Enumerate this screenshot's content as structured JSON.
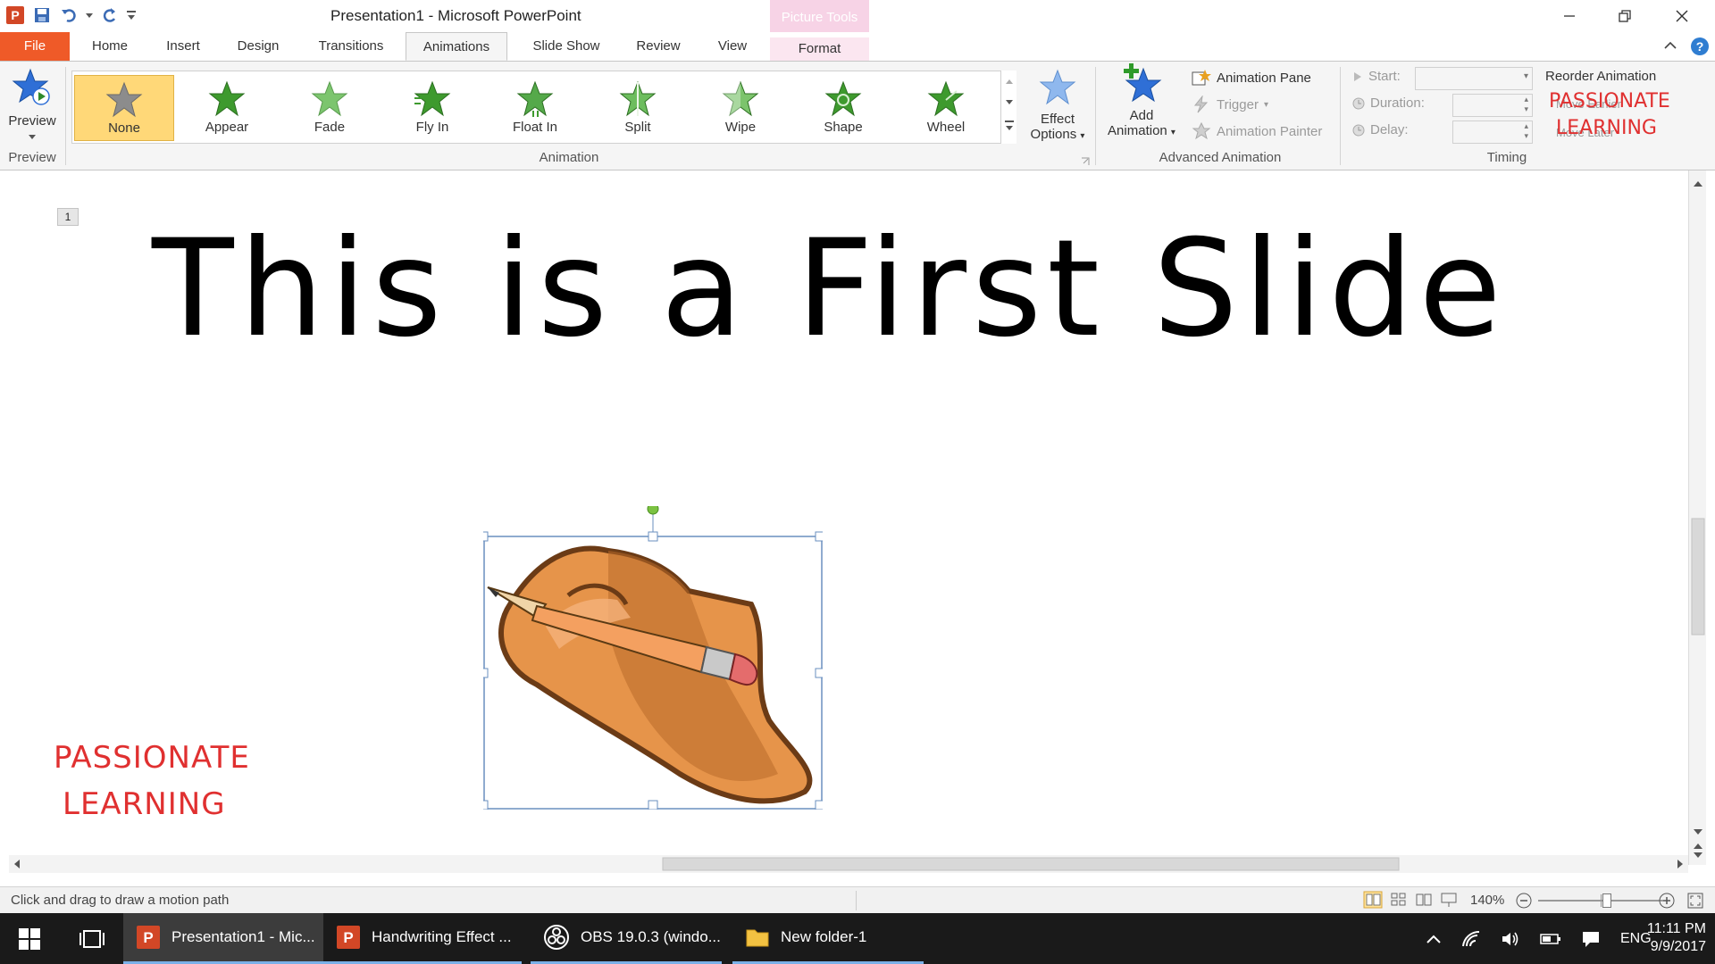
{
  "window": {
    "title": "Presentation1  -  Microsoft PowerPoint",
    "contextual_tab_group": "Picture Tools"
  },
  "tabs": [
    {
      "label": "File"
    },
    {
      "label": "Home"
    },
    {
      "label": "Insert"
    },
    {
      "label": "Design"
    },
    {
      "label": "Transitions"
    },
    {
      "label": "Animations"
    },
    {
      "label": "Slide Show"
    },
    {
      "label": "Review"
    },
    {
      "label": "View"
    },
    {
      "label": "Format"
    }
  ],
  "active_tab": "Animations",
  "ribbon": {
    "preview": {
      "button": "Preview",
      "group": "Preview"
    },
    "animation": {
      "group": "Animation",
      "items": [
        {
          "label": "None",
          "selected": true
        },
        {
          "label": "Appear"
        },
        {
          "label": "Fade"
        },
        {
          "label": "Fly In"
        },
        {
          "label": "Float In"
        },
        {
          "label": "Split"
        },
        {
          "label": "Wipe"
        },
        {
          "label": "Shape"
        },
        {
          "label": "Wheel"
        }
      ],
      "effect_options_line1": "Effect",
      "effect_options_line2": "Options"
    },
    "advanced": {
      "group": "Advanced Animation",
      "add_animation_line1": "Add",
      "add_animation_line2": "Animation",
      "animation_pane": "Animation Pane",
      "trigger": "Trigger",
      "animation_painter": "Animation Painter"
    },
    "timing": {
      "group": "Timing",
      "start": "Start:",
      "duration": "Duration:",
      "delay": "Delay:",
      "reorder": "Reorder Animation",
      "move_earlier": "Move Earlier",
      "move_later": "Move Later"
    },
    "watermark_line1": "PASSIONATE",
    "watermark_line2": "LEARNING"
  },
  "slide": {
    "number": "1",
    "title": "This is a First Slide",
    "watermark_line1": "PASSIONATE",
    "watermark_line2": "LEARNING"
  },
  "status": {
    "text": "Click and drag to draw a motion path",
    "zoom": "140%"
  },
  "taskbar": {
    "items": [
      {
        "label": "Presentation1 - Mic..."
      },
      {
        "label": "Handwriting Effect ..."
      },
      {
        "label": "OBS 19.0.3 (windo..."
      },
      {
        "label": "New folder-1"
      }
    ],
    "language": "ENG",
    "time": "11:11 PM",
    "date": "9/9/2017"
  },
  "colors": {
    "file_tab": "#ef5a28",
    "picture_tools": "#f7d3e6",
    "selected_anim": "#ffd878",
    "star_green": "#3e9a2e",
    "watermark": "#e03030"
  }
}
